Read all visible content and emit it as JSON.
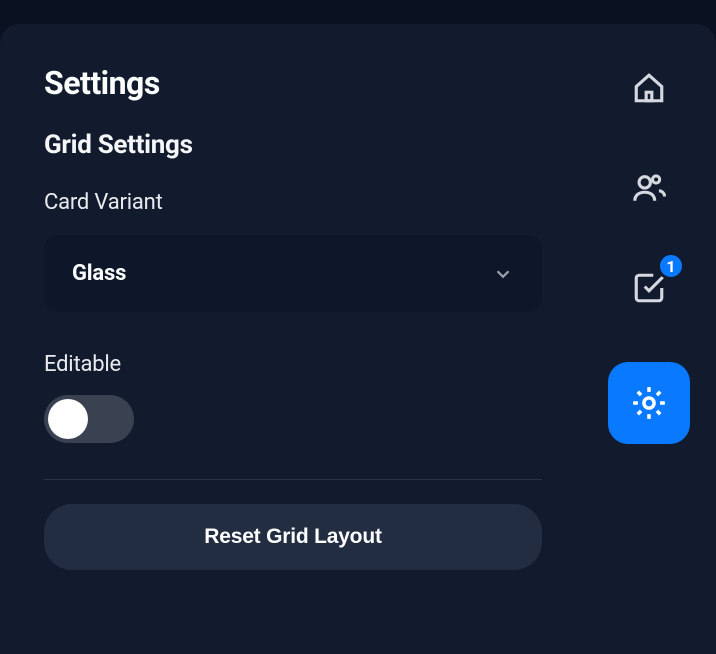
{
  "page": {
    "title": "Settings"
  },
  "section": {
    "title": "Grid Settings"
  },
  "cardVariant": {
    "label": "Card Variant",
    "value": "Glass"
  },
  "editable": {
    "label": "Editable",
    "value": false
  },
  "reset": {
    "label": "Reset Grid Layout"
  },
  "nav": {
    "home": "home",
    "users": "users",
    "tasks": "tasks",
    "tasksBadge": "1",
    "settings": "settings"
  }
}
